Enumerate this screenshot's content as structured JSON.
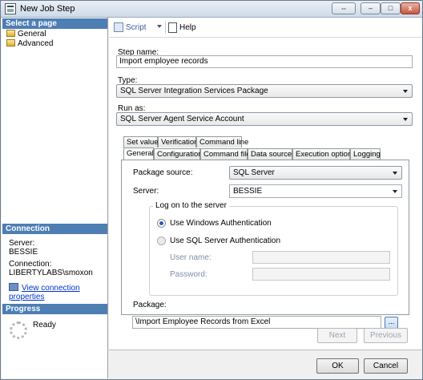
{
  "window": {
    "title": "New Job Step",
    "controls": {
      "restore": "⇔",
      "minimize": "–",
      "maximize": "□",
      "close": "x"
    }
  },
  "left": {
    "select_header": "Select a page",
    "pages": [
      "General",
      "Advanced"
    ],
    "connection_header": "Connection",
    "server_label": "Server:",
    "server_value": "BESSIE",
    "connection_label": "Connection:",
    "connection_value": "LIBERTYLABS\\smoxon",
    "view_link": "View connection properties",
    "progress_header": "Progress",
    "progress_status": "Ready"
  },
  "toolbar": {
    "script_label": "Script",
    "help_label": "Help"
  },
  "form": {
    "step_name_label": "Step name:",
    "step_name_value": "Import employee records",
    "type_label": "Type:",
    "type_value": "SQL Server Integration Services Package",
    "run_as_label": "Run as:",
    "run_as_value": "SQL Server Agent Service Account"
  },
  "tabs": {
    "row1": [
      "Set values",
      "Verification",
      "Command line"
    ],
    "row2": [
      "General",
      "Configurations",
      "Command files",
      "Data sources",
      "Execution options",
      "Logging"
    ]
  },
  "general_tab": {
    "package_source_label": "Package source:",
    "package_source_value": "SQL Server",
    "server_label": "Server:",
    "server_value": "BESSIE",
    "logon_group": "Log on to the server",
    "auth_windows": "Use Windows Authentication",
    "auth_sql": "Use SQL Server Authentication",
    "user_name_label": "User name:",
    "password_label": "Password:",
    "package_label": "Package:",
    "package_value": "\\Import Employee Records from Excel",
    "browse_label": "..."
  },
  "nav_buttons": {
    "next": "Next",
    "previous": "Previous"
  },
  "dialog_buttons": {
    "ok": "OK",
    "cancel": "Cancel"
  }
}
